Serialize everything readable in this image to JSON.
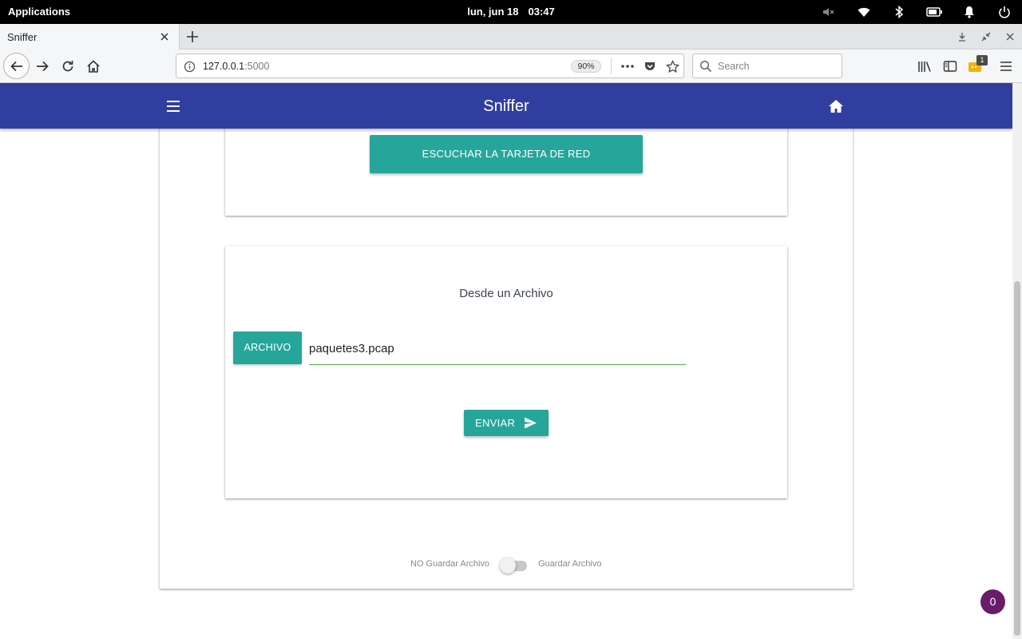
{
  "desktop": {
    "applications_label": "Applications",
    "date": "lun, jun 18",
    "time": "03:47"
  },
  "browser": {
    "tab_title": "Sniffer",
    "url_host": "127.0.0.1",
    "url_port": ":5000",
    "zoom": "90%",
    "search_placeholder": "Search",
    "extension_badge": "1"
  },
  "app": {
    "brand": "Sniffer",
    "listen_button": "ESCUCHAR LA TARJETA DE RED",
    "file_section_title": "Desde un Archivo",
    "file_button": "ARCHIVO",
    "file_path_value": "paquetes3.pcap",
    "send_button": "ENVIAR",
    "switch_off_label": "NO Guardar Archivo",
    "switch_on_label": "Guardar Archivo",
    "switch_state": false,
    "fab_count": "0"
  },
  "colors": {
    "appbar": "#303f9f",
    "accent": "#26a69a",
    "input_underline": "#4caf50",
    "fab": "#6a1b6a"
  }
}
